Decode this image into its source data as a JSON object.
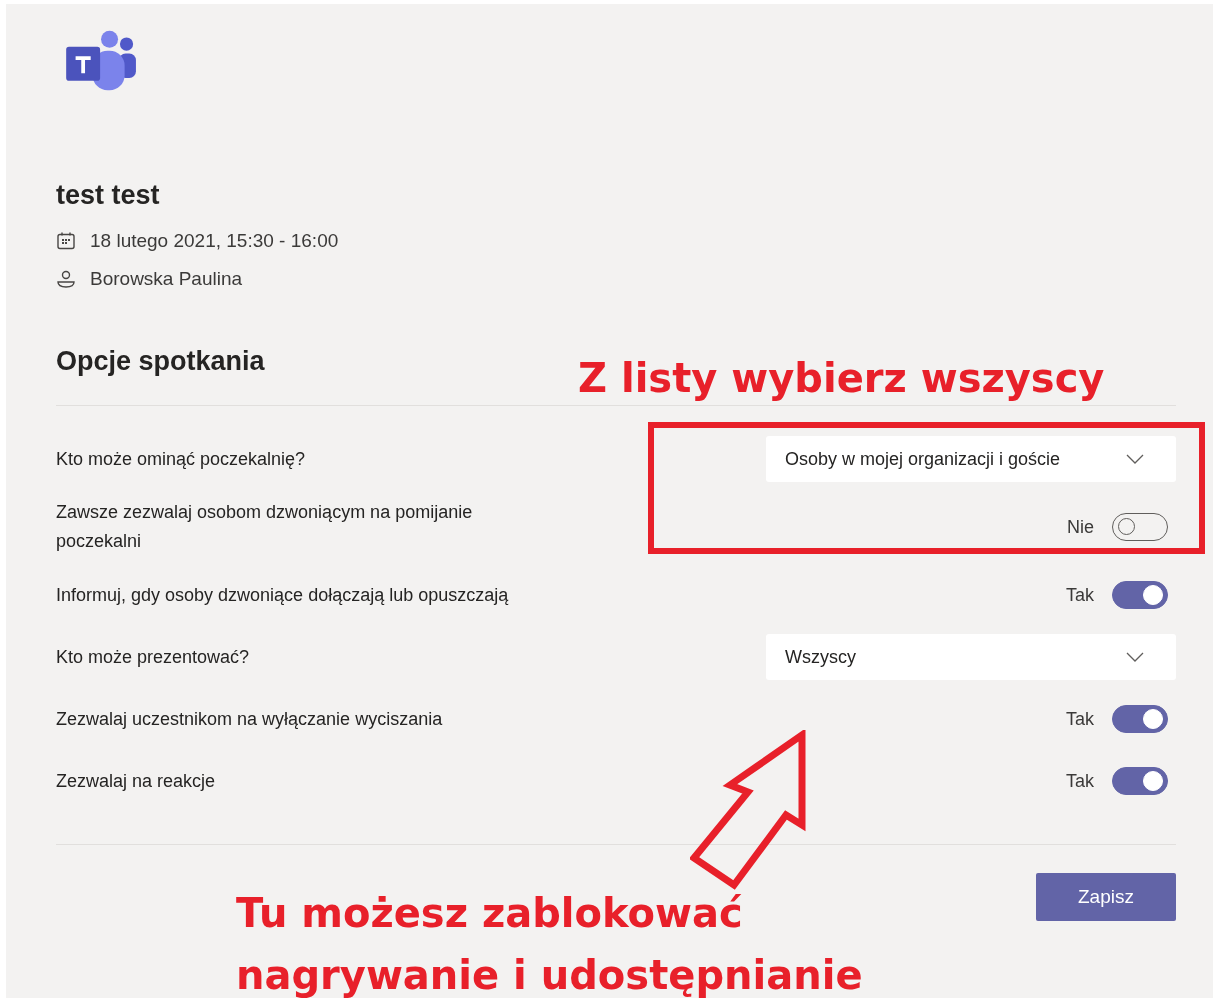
{
  "meeting": {
    "title": "test test",
    "datetime": "18 lutego 2021, 15:30 - 16:00",
    "organizer": "Borowska Paulina"
  },
  "options": {
    "title": "Opcje spotkania",
    "rows": [
      {
        "kind": "dropdown",
        "label": "Kto może ominąć poczekalnię?",
        "value": "Osoby w mojej organizacji i goście"
      },
      {
        "kind": "toggle",
        "label": "Zawsze zezwalaj osobom dzwoniącym na pomijanie poczekalni",
        "state_label": "Nie",
        "on": false
      },
      {
        "kind": "toggle",
        "label": "Informuj, gdy osoby dzwoniące dołączają lub opuszczają",
        "state_label": "Tak",
        "on": true
      },
      {
        "kind": "dropdown",
        "label": "Kto może prezentować?",
        "value": "Wszyscy"
      },
      {
        "kind": "toggle",
        "label": "Zezwalaj uczestnikom na wyłączanie wyciszania",
        "state_label": "Tak",
        "on": true
      },
      {
        "kind": "toggle",
        "label": "Zezwalaj na reakcje",
        "state_label": "Tak",
        "on": true
      }
    ]
  },
  "save_button": "Zapisz",
  "annotations": {
    "top_note": "Z listy wybierz wszyscy",
    "bottom_note": "Tu możesz zablokować nagrywanie i udostępnianie"
  }
}
